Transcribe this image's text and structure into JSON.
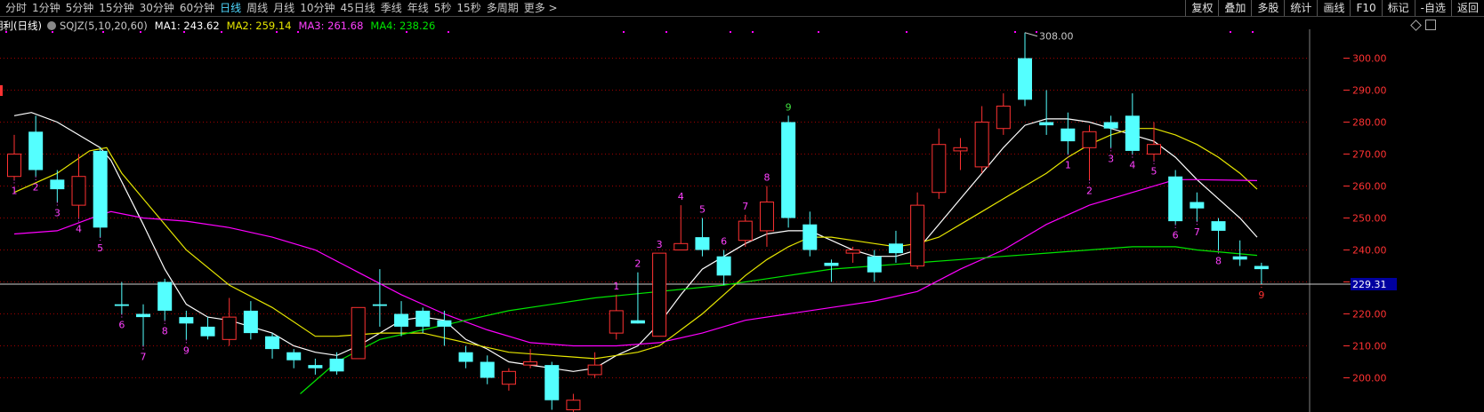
{
  "toolbar": {
    "periods": [
      "分时",
      "1分钟",
      "5分钟",
      "15分钟",
      "30分钟",
      "60分钟",
      "日线",
      "周线",
      "月线",
      "10分钟",
      "45日线",
      "季线",
      "年线",
      "5秒",
      "15秒",
      "多周期",
      "更多 >"
    ],
    "active": 6,
    "tools": [
      "复权",
      "叠加",
      "多股",
      "统计",
      "画线",
      "F10",
      "标记",
      "-自选",
      "返回"
    ]
  },
  "info": {
    "title": "明利(日线)",
    "indicator": "SQJZ(5,10,20,60)",
    "ma1": "MA1: 243.62",
    "ma2": "MA2: 259.14",
    "ma3": "MA3: 261.68",
    "ma4": "MA4: 238.26"
  },
  "colors": {
    "up": "#ff3232",
    "down": "#54ffff",
    "ma1": "#ffffff",
    "ma2": "#e6e600",
    "ma3": "#ff00ff",
    "ma4": "#00e600",
    "grid": "#a00000",
    "axis": "#ff3232",
    "label": "#ff40ff",
    "label9": "#40e040",
    "current_box": "#0000a0"
  },
  "icons": [
    "diamond-icon",
    "window-icon"
  ],
  "chart_data": {
    "type": "candlestick",
    "y_axis": {
      "ticks": [
        200,
        210,
        220,
        230,
        240,
        250,
        260,
        270,
        280,
        290,
        300
      ],
      "labels": [
        "200.00",
        "210.00",
        "220.00",
        "230.00",
        "240.00",
        "250.00",
        "260.00",
        "270.00",
        "280.00",
        "290.00",
        "300.00"
      ]
    },
    "current_price": "229.31",
    "max_label": "308.00",
    "candles": [
      {
        "o": 263,
        "c": 270,
        "h": 276,
        "l": 262,
        "n": "1"
      },
      {
        "o": 277,
        "c": 265,
        "h": 282,
        "l": 263,
        "n": "2"
      },
      {
        "o": 262,
        "c": 259,
        "h": 265,
        "l": 255,
        "n": "3"
      },
      {
        "o": 254,
        "c": 263,
        "h": 270,
        "l": 250,
        "n": "4"
      },
      {
        "o": 271,
        "c": 247,
        "h": 272,
        "l": 244,
        "n": "5"
      },
      {
        "o": 223,
        "c": 222.5,
        "h": 230,
        "l": 220,
        "n": "6"
      },
      {
        "o": 220,
        "c": 219,
        "h": 223,
        "l": 210,
        "n": "7"
      },
      {
        "o": 230,
        "c": 221,
        "h": 231,
        "l": 218,
        "n": "8"
      },
      {
        "o": 219,
        "c": 217,
        "h": 221,
        "l": 212,
        "n": "9"
      },
      {
        "o": 216,
        "c": 213,
        "h": 219,
        "l": 212,
        "n": ""
      },
      {
        "o": 212,
        "c": 219,
        "h": 225,
        "l": 210,
        "n": ""
      },
      {
        "o": 221,
        "c": 214,
        "h": 224,
        "l": 212,
        "n": ""
      },
      {
        "o": 213,
        "c": 209,
        "h": 214,
        "l": 206,
        "n": ""
      },
      {
        "o": 208,
        "c": 205.5,
        "h": 209,
        "l": 203,
        "n": ""
      },
      {
        "o": 204,
        "c": 203,
        "h": 206,
        "l": 201,
        "n": ""
      },
      {
        "o": 206,
        "c": 202,
        "h": 208,
        "l": 201,
        "n": ""
      },
      {
        "o": 206,
        "c": 222,
        "h": 222,
        "l": 206,
        "n": ""
      },
      {
        "o": 223,
        "c": 222.5,
        "h": 234,
        "l": 216,
        "n": ""
      },
      {
        "o": 220,
        "c": 216,
        "h": 224,
        "l": 213,
        "n": ""
      },
      {
        "o": 221,
        "c": 216,
        "h": 222,
        "l": 214,
        "n": ""
      },
      {
        "o": 218,
        "c": 216,
        "h": 221,
        "l": 210,
        "n": ""
      },
      {
        "o": 208,
        "c": 205,
        "h": 210,
        "l": 203,
        "n": ""
      },
      {
        "o": 205,
        "c": 200,
        "h": 207,
        "l": 198,
        "n": ""
      },
      {
        "o": 198,
        "c": 202,
        "h": 203,
        "l": 196,
        "n": ""
      },
      {
        "o": 204,
        "c": 205,
        "h": 209,
        "l": 203,
        "n": ""
      },
      {
        "o": 204,
        "c": 193,
        "h": 205,
        "l": 190,
        "n": ""
      },
      {
        "o": 190,
        "c": 193,
        "h": 195,
        "l": 188,
        "n": ""
      },
      {
        "o": 201,
        "c": 204,
        "h": 208,
        "l": 200,
        "n": ""
      },
      {
        "o": 214,
        "c": 221,
        "h": 226,
        "l": 212,
        "n": "1"
      },
      {
        "o": 218,
        "c": 217,
        "h": 233,
        "l": 217,
        "n": "2"
      },
      {
        "o": 213,
        "c": 239,
        "h": 239,
        "l": 213,
        "n": "3"
      },
      {
        "o": 240,
        "c": 242,
        "h": 254,
        "l": 240,
        "n": "4"
      },
      {
        "o": 244,
        "c": 240,
        "h": 250,
        "l": 238,
        "n": "5"
      },
      {
        "o": 238,
        "c": 232,
        "h": 240,
        "l": 229,
        "n": "6"
      },
      {
        "o": 243,
        "c": 249,
        "h": 251,
        "l": 241,
        "n": "7"
      },
      {
        "o": 246,
        "c": 255,
        "h": 260,
        "l": 241,
        "n": "8"
      },
      {
        "o": 280,
        "c": 250,
        "h": 282,
        "l": 247,
        "n": "9"
      },
      {
        "o": 248,
        "c": 240,
        "h": 252,
        "l": 238,
        "n": ""
      },
      {
        "o": 236,
        "c": 235,
        "h": 237,
        "l": 230,
        "n": ""
      },
      {
        "o": 239,
        "c": 240,
        "h": 241,
        "l": 236,
        "n": ""
      },
      {
        "o": 238,
        "c": 233,
        "h": 240,
        "l": 230,
        "n": ""
      },
      {
        "o": 242,
        "c": 239,
        "h": 246,
        "l": 236,
        "n": ""
      },
      {
        "o": 235,
        "c": 254,
        "h": 258,
        "l": 234,
        "n": ""
      },
      {
        "o": 258,
        "c": 273,
        "h": 278,
        "l": 256,
        "n": ""
      },
      {
        "o": 271,
        "c": 272,
        "h": 275,
        "l": 265,
        "n": ""
      },
      {
        "o": 266,
        "c": 280,
        "h": 285,
        "l": 264,
        "n": ""
      },
      {
        "o": 278,
        "c": 285,
        "h": 289,
        "l": 276,
        "n": ""
      },
      {
        "o": 300,
        "c": 287,
        "h": 308,
        "l": 285,
        "n": ""
      },
      {
        "o": 280,
        "c": 279,
        "h": 290,
        "l": 276,
        "n": ""
      },
      {
        "o": 278,
        "c": 274,
        "h": 283,
        "l": 270,
        "n": "1"
      },
      {
        "o": 272,
        "c": 277,
        "h": 279,
        "l": 262,
        "n": "2"
      },
      {
        "o": 280,
        "c": 278,
        "h": 282,
        "l": 272,
        "n": "3"
      },
      {
        "o": 282,
        "c": 271,
        "h": 289,
        "l": 270,
        "n": "4"
      },
      {
        "o": 270,
        "c": 273,
        "h": 280,
        "l": 268,
        "n": "5"
      },
      {
        "o": 263,
        "c": 249,
        "h": 265,
        "l": 248,
        "n": "6"
      },
      {
        "o": 255,
        "c": 253,
        "h": 258,
        "l": 249,
        "n": "7"
      },
      {
        "o": 249,
        "c": 246,
        "h": 250,
        "l": 240,
        "n": "8"
      },
      {
        "o": 238,
        "c": 237,
        "h": 243,
        "l": 235,
        "n": ""
      },
      {
        "o": 235,
        "c": 234,
        "h": 236,
        "l": 229.31,
        "n": "9"
      }
    ],
    "ma1": [
      [
        0,
        282
      ],
      [
        0.8,
        283
      ],
      [
        2,
        280
      ],
      [
        4,
        272
      ],
      [
        4.5,
        268
      ],
      [
        6,
        248
      ],
      [
        7,
        234
      ],
      [
        8,
        223
      ],
      [
        9,
        219
      ],
      [
        10,
        218
      ],
      [
        11,
        216
      ],
      [
        12,
        214
      ],
      [
        13,
        210
      ],
      [
        14,
        208
      ],
      [
        15,
        207
      ],
      [
        16,
        210
      ],
      [
        17,
        214
      ],
      [
        18,
        218
      ],
      [
        19,
        219
      ],
      [
        20,
        218
      ],
      [
        21,
        212
      ],
      [
        22,
        209
      ],
      [
        23,
        205
      ],
      [
        24,
        204
      ],
      [
        25,
        203
      ],
      [
        26,
        202
      ],
      [
        27,
        203
      ],
      [
        28,
        207
      ],
      [
        29,
        210
      ],
      [
        30,
        217
      ],
      [
        31,
        226
      ],
      [
        32,
        234
      ],
      [
        33,
        238
      ],
      [
        34,
        242
      ],
      [
        35,
        245
      ],
      [
        36,
        246
      ],
      [
        37,
        246
      ],
      [
        38,
        243
      ],
      [
        39,
        240
      ],
      [
        40,
        238
      ],
      [
        41,
        238
      ],
      [
        42,
        240
      ],
      [
        43,
        248
      ],
      [
        44,
        256
      ],
      [
        45,
        264
      ],
      [
        46,
        272
      ],
      [
        47,
        279
      ],
      [
        48,
        281
      ],
      [
        49,
        281
      ],
      [
        50,
        280
      ],
      [
        51,
        278
      ],
      [
        52,
        276
      ],
      [
        53,
        274
      ],
      [
        54,
        269
      ],
      [
        55,
        262
      ],
      [
        56,
        256
      ],
      [
        57,
        250
      ],
      [
        57.8,
        244
      ]
    ],
    "ma2": [
      [
        0,
        258
      ],
      [
        2,
        264
      ],
      [
        3.5,
        271
      ],
      [
        4.3,
        272
      ],
      [
        5,
        264
      ],
      [
        6,
        256
      ],
      [
        8,
        240
      ],
      [
        10,
        229
      ],
      [
        12,
        222
      ],
      [
        14,
        213
      ],
      [
        15,
        213
      ],
      [
        17,
        214
      ],
      [
        19,
        214
      ],
      [
        21,
        211
      ],
      [
        23,
        208
      ],
      [
        25,
        207
      ],
      [
        27,
        206
      ],
      [
        28,
        207
      ],
      [
        29,
        208
      ],
      [
        30,
        210
      ],
      [
        31,
        215
      ],
      [
        32,
        220
      ],
      [
        33,
        226
      ],
      [
        34,
        232
      ],
      [
        35,
        237
      ],
      [
        36,
        241
      ],
      [
        37,
        244
      ],
      [
        38,
        244
      ],
      [
        39,
        243
      ],
      [
        40,
        242
      ],
      [
        41,
        241
      ],
      [
        42,
        242
      ],
      [
        43,
        244
      ],
      [
        44,
        248
      ],
      [
        45,
        252
      ],
      [
        46,
        256
      ],
      [
        47,
        260
      ],
      [
        48,
        264
      ],
      [
        49,
        269
      ],
      [
        50,
        273
      ],
      [
        51,
        276
      ],
      [
        52,
        278
      ],
      [
        53,
        278
      ],
      [
        54,
        276
      ],
      [
        55,
        273
      ],
      [
        56,
        269
      ],
      [
        57,
        264
      ],
      [
        57.8,
        259
      ]
    ],
    "ma3": [
      [
        0,
        245
      ],
      [
        2,
        246
      ],
      [
        4,
        251
      ],
      [
        4.5,
        252
      ],
      [
        6,
        250
      ],
      [
        8,
        249
      ],
      [
        10,
        247
      ],
      [
        12,
        244
      ],
      [
        14,
        240
      ],
      [
        16,
        233
      ],
      [
        18,
        226
      ],
      [
        20,
        220
      ],
      [
        22,
        215
      ],
      [
        24,
        211
      ],
      [
        26,
        210
      ],
      [
        28,
        210
      ],
      [
        30,
        211
      ],
      [
        32,
        214
      ],
      [
        34,
        218
      ],
      [
        36,
        220
      ],
      [
        38,
        222
      ],
      [
        40,
        224
      ],
      [
        42,
        227
      ],
      [
        44,
        234
      ],
      [
        46,
        240
      ],
      [
        48,
        248
      ],
      [
        50,
        254
      ],
      [
        52,
        258
      ],
      [
        54,
        262
      ],
      [
        55,
        262
      ],
      [
        57.8,
        261.7
      ]
    ],
    "ma4": [
      [
        13.3,
        195
      ],
      [
        15,
        205
      ],
      [
        17,
        212
      ],
      [
        19,
        215
      ],
      [
        21,
        218
      ],
      [
        23,
        221
      ],
      [
        25,
        223
      ],
      [
        27,
        225
      ],
      [
        30,
        227
      ],
      [
        33,
        229
      ],
      [
        36,
        232
      ],
      [
        38,
        234
      ],
      [
        40,
        235
      ],
      [
        42,
        236
      ],
      [
        44,
        237
      ],
      [
        46,
        238
      ],
      [
        48,
        239
      ],
      [
        50,
        240
      ],
      [
        52,
        241
      ],
      [
        54,
        241
      ],
      [
        55,
        240
      ],
      [
        57.8,
        238.3
      ]
    ]
  }
}
